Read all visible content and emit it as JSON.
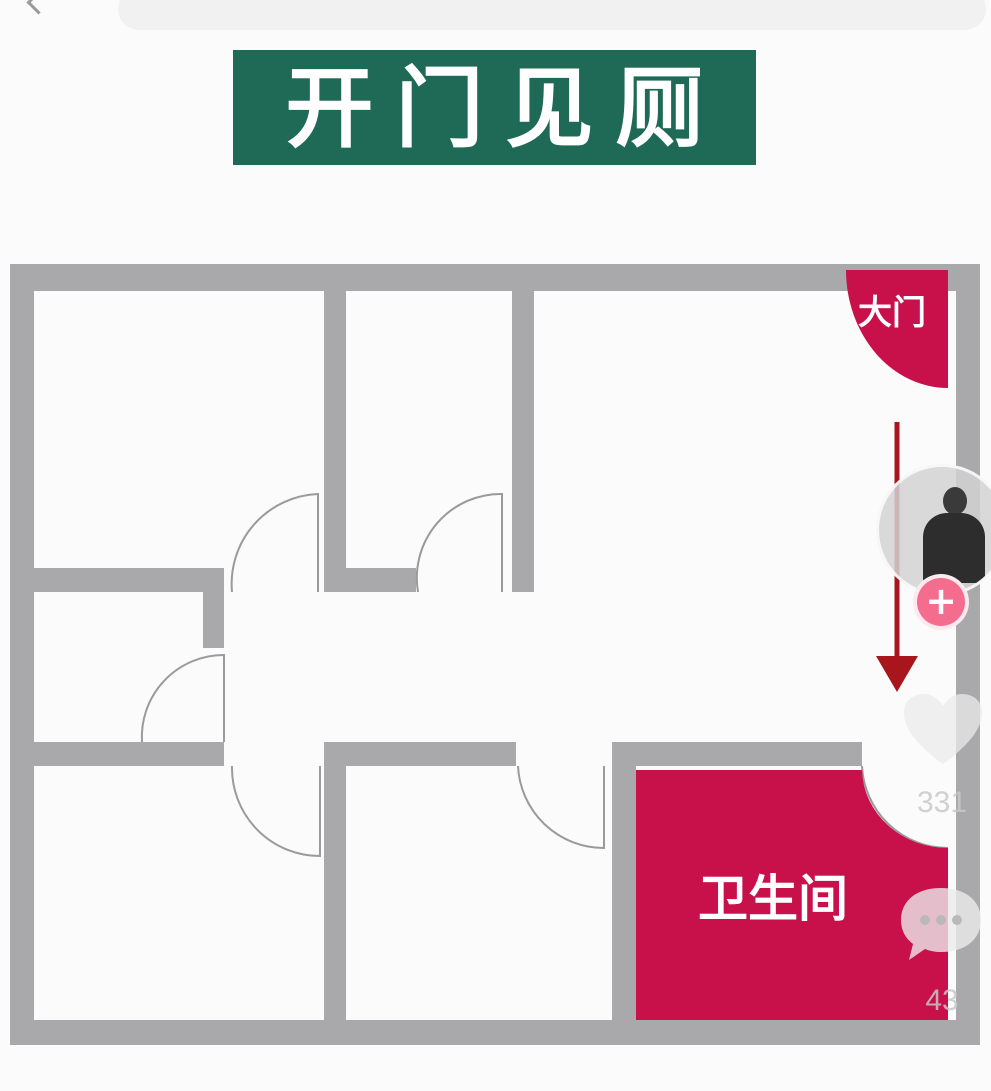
{
  "title": "开门见厕",
  "labels": {
    "main_door": "大门",
    "bathroom": "卫生间"
  },
  "sidebar": {
    "likes": "331",
    "comments": "43"
  },
  "colors": {
    "banner": "#1e6a57",
    "accent": "#c8104a",
    "wall": "#a9a9ab",
    "arrow": "#a8151c"
  },
  "icons": {
    "back": "chevron-left-icon",
    "follow": "plus-icon",
    "like": "heart-icon",
    "comment": "speech-bubble-icon"
  }
}
